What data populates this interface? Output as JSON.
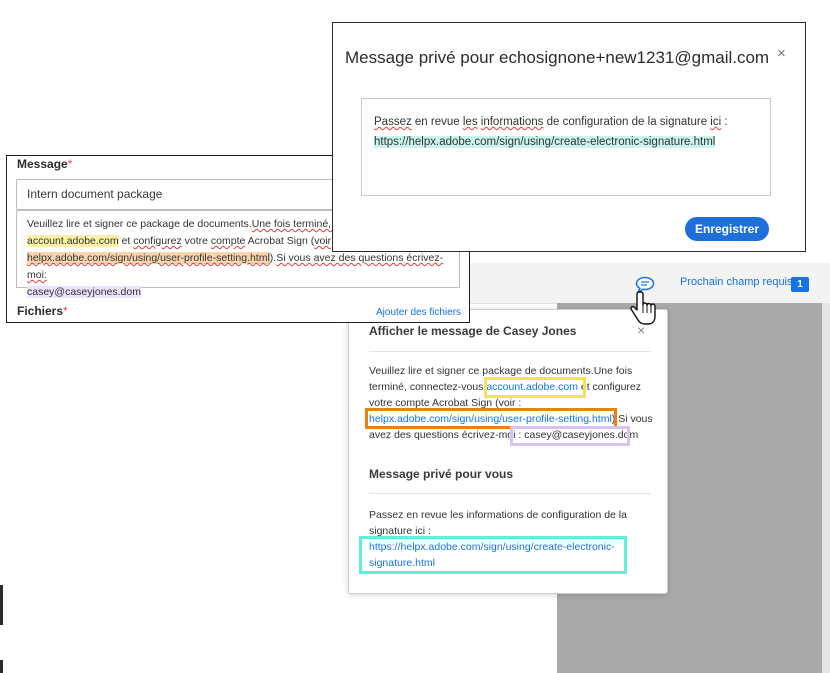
{
  "toolbar": {
    "next_field_label": "Prochain champ requis",
    "next_field_count": "1"
  },
  "popover": {
    "close": "×",
    "heading1": "Afficher le message de Casey Jones",
    "p1_a": "Veuillez lire et signer ce package de documents.Une fois terminé, connectez-vous ",
    "p1_link1": "account.adobe.com",
    "p1_b": " et configurez votre compte Acrobat Sign (voir : ",
    "p1_link2": "helpx.adobe.com/sign/using/user-profile-setting.html",
    "p1_c": ").Si vous avez des questions écrivez-moi : ",
    "p1_email": "casey@caseyjones.dom",
    "heading2": "Message privé pour vous",
    "p2": "Passez en revue les informations de configuration de la signature ici :",
    "p2_link": "https://helpx.adobe.com/sign/using/create-electronic-signature.html"
  },
  "message_panel": {
    "label": "Message",
    "required_mark": "*",
    "subject": "Intern document package",
    "b1": "Veuillez lire et signer ce package de documents.",
    "b2": "Une fois terminé, connectez-vous à",
    "b3": "account.adobe.com",
    "b4": " et ",
    "b5": "configurez",
    "b6": " votre ",
    "b7": "compte",
    "b8": " Acrobat Sign (",
    "b9": "voir",
    "b10": " : ",
    "b11": "helpx.adobe.com/sign/using/user-profile-setting.html",
    "b12": ").",
    "b13": "Si vous avez des questions écrivez-moi:",
    "b14": "casey@caseyjones.dom",
    "files_label": "Fichiers",
    "add_files": "Ajouter des fichiers"
  },
  "dialog": {
    "title": "Message privé pour echosignone+new1231@gmail.com",
    "close": "×",
    "t1": "Passez",
    "t2": " en revue ",
    "t3": "les",
    "t4": " ",
    "t5": "informations",
    "t6": " de configuration de la signature ",
    "t7": "ici",
    "t8": " :",
    "url": "https://helpx.adobe.com/sign/using/create-electronic-signature.html",
    "save_label": "Enregistrer"
  },
  "colors": {
    "accent": "#1473e6",
    "highlight_yellow": "#f7e34f",
    "highlight_orange": "#e9820f",
    "highlight_purple": "#d8c2f5",
    "highlight_cyan": "#5ef0db"
  },
  "icons": {
    "chat": "chat-bubble-icon",
    "cursor": "hand-pointer-icon"
  }
}
